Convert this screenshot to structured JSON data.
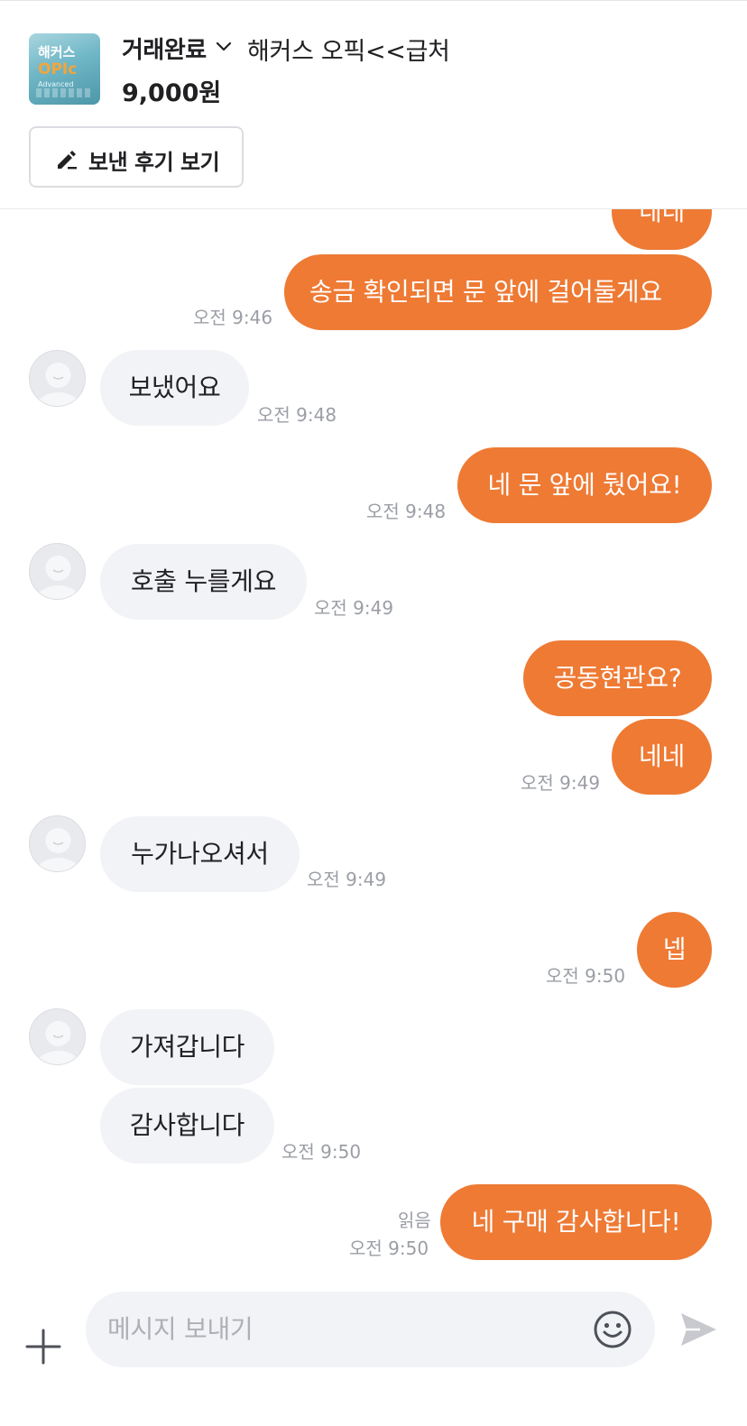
{
  "product": {
    "status": "거래완료",
    "title": "해커스 오픽<<급처",
    "price": "9,000원",
    "thumbnail": {
      "line1": "해커스",
      "line2": "OPIc",
      "line3": "Advanced"
    },
    "review_button_label": "보낸 후기 보기"
  },
  "messages": [
    {
      "from": "me",
      "text": "네네"
    },
    {
      "from": "me",
      "text": "송금 확인되면 문 앞에 걸어둘게요",
      "time": "오전 9:46"
    },
    {
      "from": "them",
      "text": "보냈어요",
      "time": "오전 9:48"
    },
    {
      "from": "me",
      "text": "네 문 앞에 뒀어요!",
      "time": "오전 9:48"
    },
    {
      "from": "them",
      "text": "호출 누를게요",
      "time": "오전 9:49"
    },
    {
      "from": "me",
      "text": "공동현관요?"
    },
    {
      "from": "me",
      "text": "네네",
      "time": "오전 9:49"
    },
    {
      "from": "them",
      "text": "누가나오셔서",
      "time": "오전 9:49"
    },
    {
      "from": "me",
      "text": "넵",
      "time": "오전 9:50"
    },
    {
      "from": "them",
      "text": "가져갑니다"
    },
    {
      "from": "them",
      "text": "감사합니다",
      "time": "오전 9:50"
    },
    {
      "from": "me",
      "text": "네 구매 감사합니다!",
      "time": "오전 9:50",
      "read": "읽음"
    }
  ],
  "composer": {
    "placeholder": "메시지 보내기",
    "plus_icon": "plus-icon",
    "emoji_icon": "smiley-icon",
    "send_icon": "paper-plane-icon"
  },
  "colors": {
    "my_bubble": "#ee7a34",
    "their_bubble": "#f2f3f6",
    "timestamp": "#9b9ea5"
  }
}
